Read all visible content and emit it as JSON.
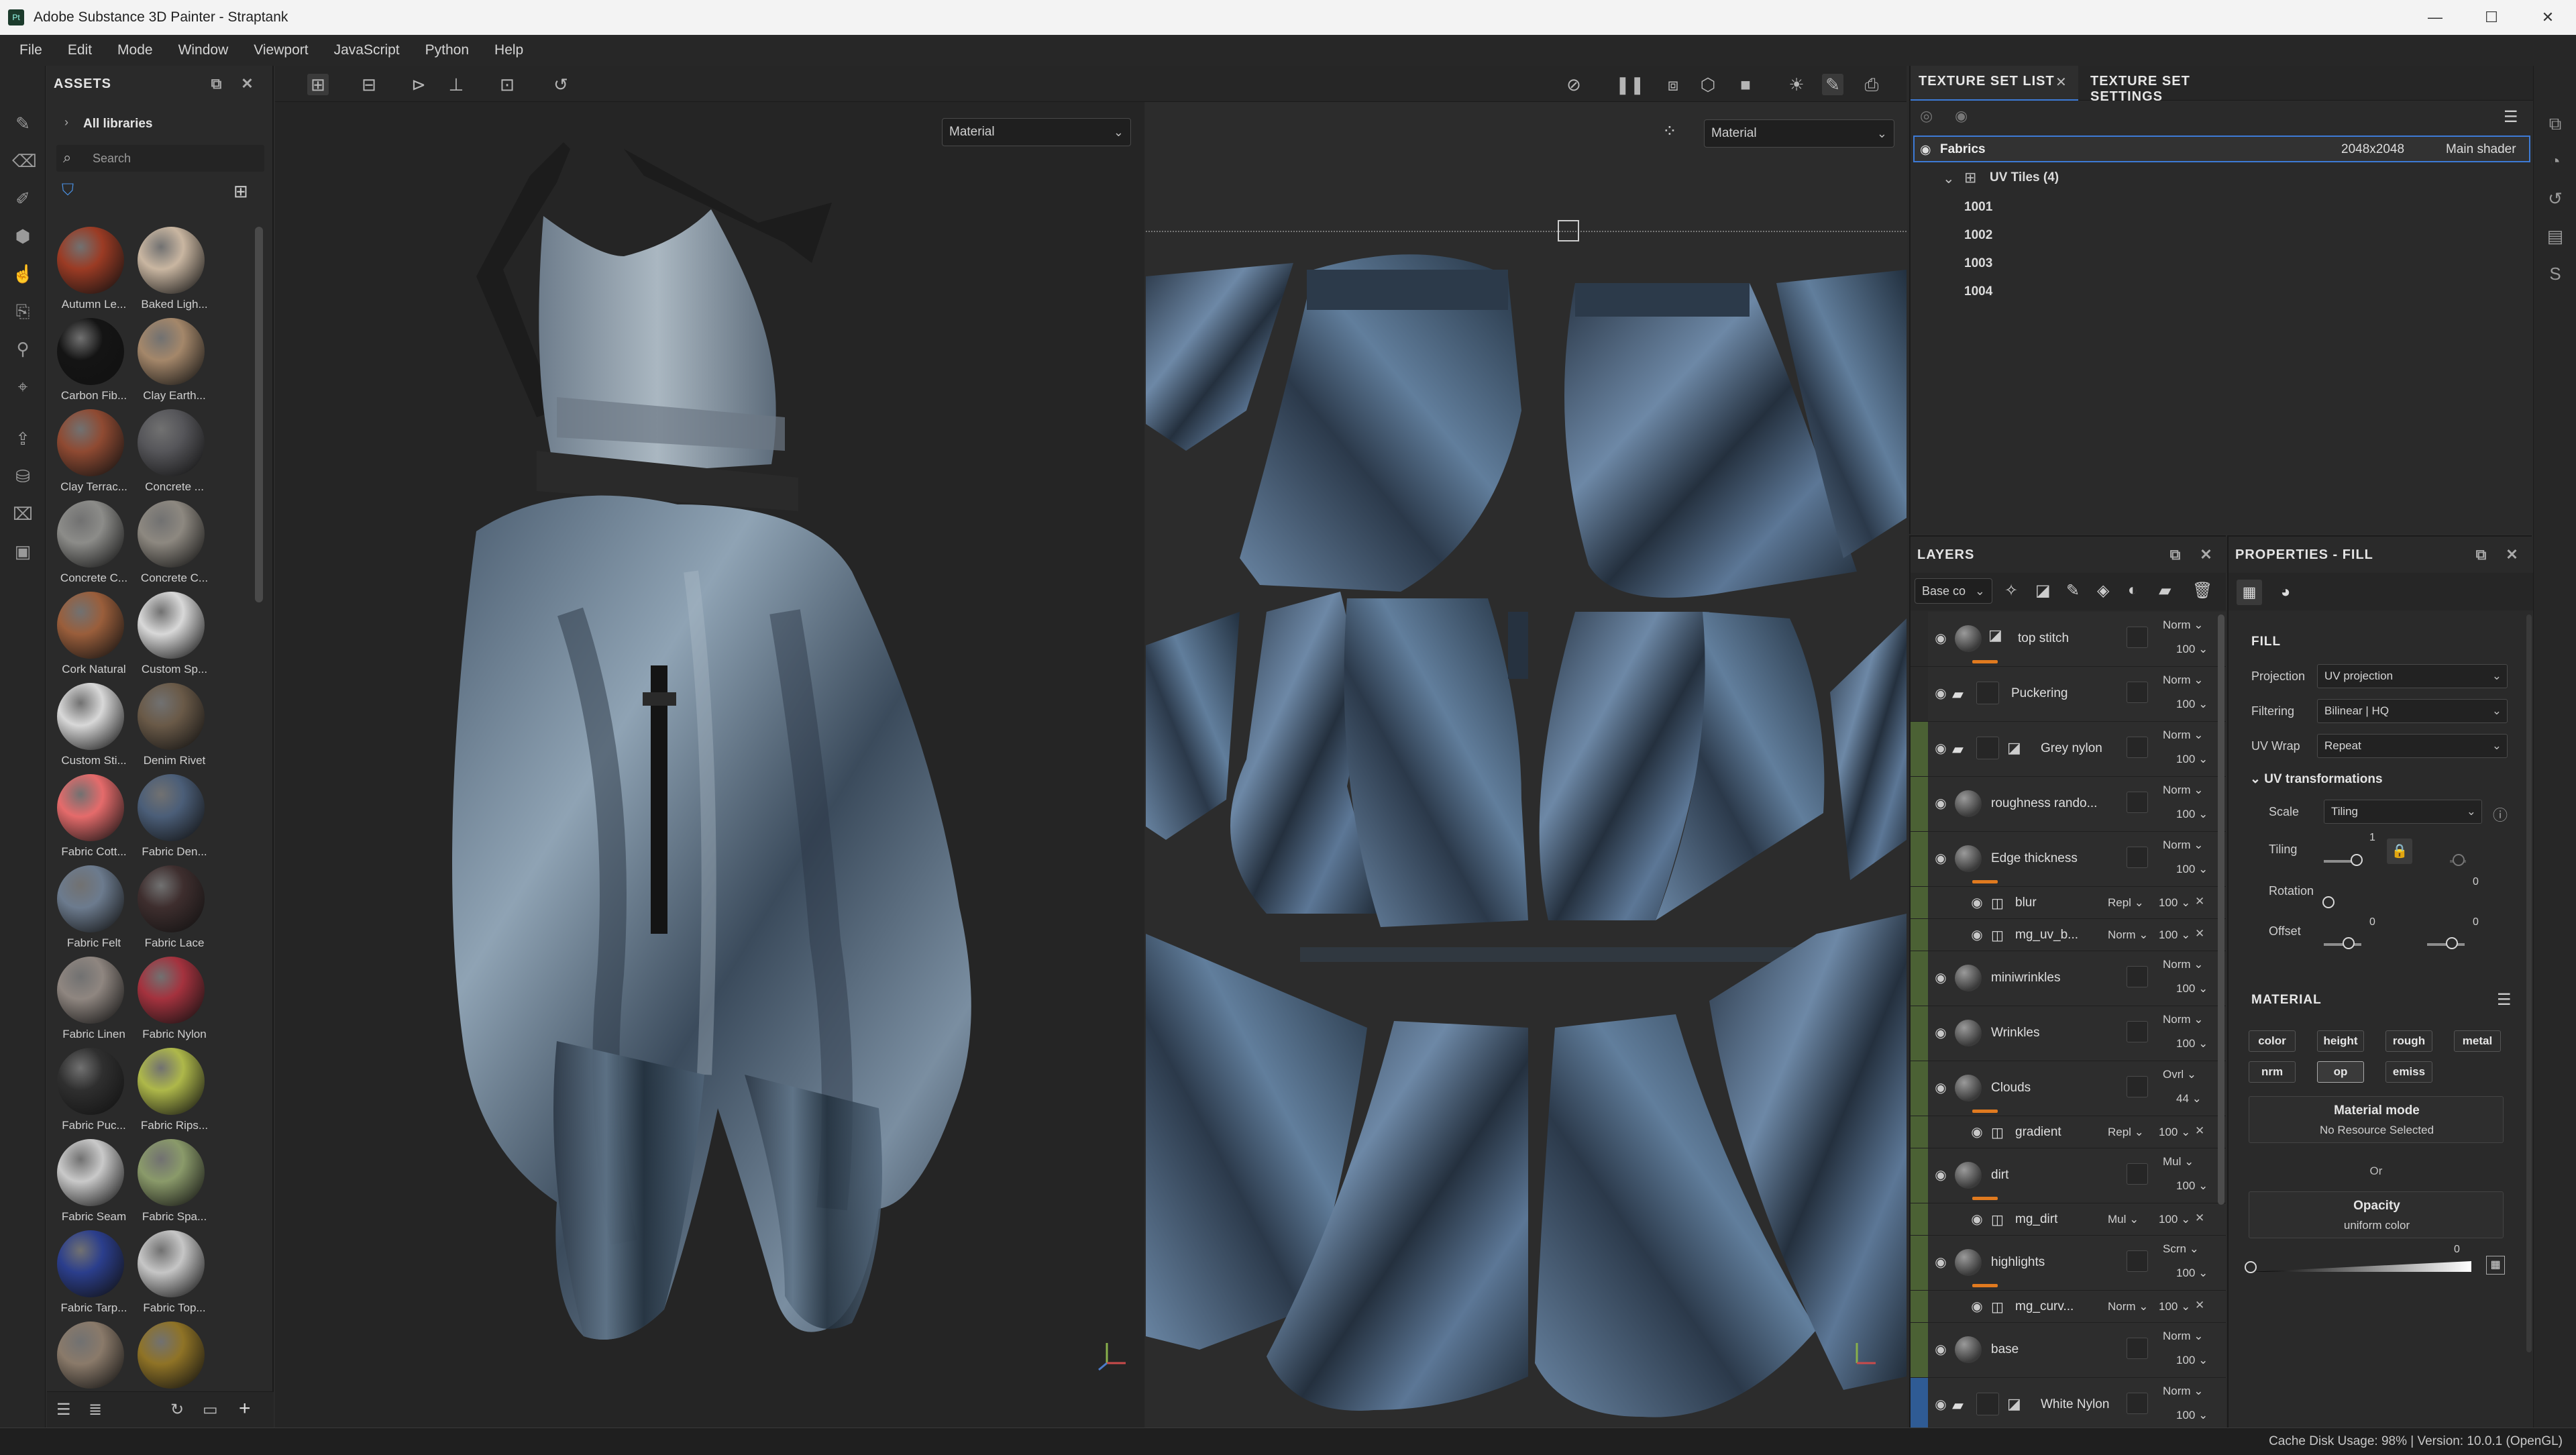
{
  "window": {
    "title": "Adobe Substance 3D Painter - Straptank",
    "app_icon": "Pt",
    "minimize": "—",
    "maximize": "☐",
    "close": "✕"
  },
  "menu": [
    "File",
    "Edit",
    "Mode",
    "Window",
    "Viewport",
    "JavaScript",
    "Python",
    "Help"
  ],
  "assets": {
    "title": "ASSETS",
    "library": "All libraries",
    "search_placeholder": "Search",
    "materials": [
      {
        "label": "Autumn Le...",
        "color": "#9b3b24"
      },
      {
        "label": "Baked Ligh...",
        "color": "#c9b6a1"
      },
      {
        "label": "Carbon Fib...",
        "color": "#141414"
      },
      {
        "label": "Clay Earth...",
        "color": "#a4876a"
      },
      {
        "label": "Clay Terrac...",
        "color": "#8f4a32"
      },
      {
        "label": "Concrete ...",
        "color": "#56565a"
      },
      {
        "label": "Concrete C...",
        "color": "#8c8c89"
      },
      {
        "label": "Concrete C...",
        "color": "#8d8880"
      },
      {
        "label": "Cork Natural",
        "color": "#9a5e3b"
      },
      {
        "label": "Custom Sp...",
        "color": "#d8d8d8"
      },
      {
        "label": "Custom Sti...",
        "color": "#d8d8d8"
      },
      {
        "label": "Denim Rivet",
        "color": "#6a5a48"
      },
      {
        "label": "Fabric Cott...",
        "color": "#e56b6b"
      },
      {
        "label": "Fabric Den...",
        "color": "#4b5e78"
      },
      {
        "label": "Fabric Felt",
        "color": "#6c7b8e"
      },
      {
        "label": "Fabric Lace",
        "color": "#3e2e2e"
      },
      {
        "label": "Fabric Linen",
        "color": "#8f8680"
      },
      {
        "label": "Fabric Nylon",
        "color": "#a4323e"
      },
      {
        "label": "Fabric Puc...",
        "color": "#2f2f2f"
      },
      {
        "label": "Fabric Rips...",
        "color": "#aeb84a"
      },
      {
        "label": "Fabric Seam",
        "color": "#c9c9c9"
      },
      {
        "label": "Fabric Spa...",
        "color": "#8a9a6a"
      },
      {
        "label": "Fabric Tarp...",
        "color": "#2b3e8c"
      },
      {
        "label": "Fabric Top...",
        "color": "#c6c6c6"
      },
      {
        "label": "",
        "color": "#8a7a6a"
      },
      {
        "label": "",
        "color": "#8f7326"
      }
    ]
  },
  "viewport": {
    "left_mode": "Material",
    "right_mode": "Material"
  },
  "texture_set": {
    "tab_list": "TEXTURE SET LIST",
    "tab_settings": "TEXTURE SET SETTINGS",
    "row_name": "Fabrics",
    "row_res": "2048x2048",
    "row_shader": "Main shader",
    "uv_group": "UV Tiles (4)",
    "tiles": [
      "1001",
      "1002",
      "1003",
      "1004"
    ]
  },
  "layers": {
    "title": "LAYERS",
    "channel": "Base co",
    "rows": [
      {
        "name": "top stitch",
        "blend": "Norm",
        "opacity": "100",
        "kind": "fill",
        "gut": "",
        "orange": true
      },
      {
        "name": "Puckering",
        "blend": "Norm",
        "opacity": "100",
        "kind": "folder",
        "gut": "",
        "orange": false
      },
      {
        "name": "Grey nylon",
        "blend": "Norm",
        "opacity": "100",
        "kind": "folder",
        "gut": "green",
        "orange": false
      },
      {
        "name": "roughness rando...",
        "blend": "Norm",
        "opacity": "100",
        "kind": "fill",
        "gut": "green",
        "orange": false
      },
      {
        "name": "Edge thickness",
        "blend": "Norm",
        "opacity": "100",
        "kind": "fill",
        "gut": "green",
        "orange": true
      },
      {
        "name": "blur",
        "blend": "Repl",
        "opacity": "100",
        "kind": "effect",
        "gut": "green",
        "orange": false
      },
      {
        "name": "mg_uv_b...",
        "blend": "Norm",
        "opacity": "100",
        "kind": "effect",
        "gut": "green",
        "orange": false
      },
      {
        "name": "miniwrinkles",
        "blend": "Norm",
        "opacity": "100",
        "kind": "fill",
        "gut": "green",
        "orange": false
      },
      {
        "name": "Wrinkles",
        "blend": "Norm",
        "opacity": "100",
        "kind": "fill",
        "gut": "green",
        "orange": false
      },
      {
        "name": "Clouds",
        "blend": "Ovrl",
        "opacity": "44",
        "kind": "fill",
        "gut": "green",
        "orange": true
      },
      {
        "name": "gradient",
        "blend": "Repl",
        "opacity": "100",
        "kind": "effect",
        "gut": "green",
        "orange": false
      },
      {
        "name": "dirt",
        "blend": "Mul",
        "opacity": "100",
        "kind": "fill",
        "gut": "green",
        "orange": true
      },
      {
        "name": "mg_dirt",
        "blend": "Mul",
        "opacity": "100",
        "kind": "effect",
        "gut": "green",
        "orange": false
      },
      {
        "name": "highlights",
        "blend": "Scrn",
        "opacity": "100",
        "kind": "fill",
        "gut": "green",
        "orange": true
      },
      {
        "name": "mg_curv...",
        "blend": "Norm",
        "opacity": "100",
        "kind": "effect",
        "gut": "green",
        "orange": false
      },
      {
        "name": "base",
        "blend": "Norm",
        "opacity": "100",
        "kind": "fill",
        "gut": "green",
        "orange": false
      },
      {
        "name": "White Nylon",
        "blend": "Norm",
        "opacity": "100",
        "kind": "folder",
        "gut": "blue",
        "orange": false
      }
    ]
  },
  "properties": {
    "title": "PROPERTIES - FILL",
    "fill": "FILL",
    "projection_label": "Projection",
    "projection": "UV projection",
    "filtering_label": "Filtering",
    "filtering": "Bilinear | HQ",
    "uvwrap_label": "UV Wrap",
    "uvwrap": "Repeat",
    "uvtrans": "UV transformations",
    "scale_label": "Scale",
    "scale": "Tiling",
    "tiling_label": "Tiling",
    "tiling_value": "1",
    "rotation_label": "Rotation",
    "rotation_value": "0",
    "offset_label": "Offset",
    "offset_x": "0",
    "offset_y": "0",
    "material": "MATERIAL",
    "channels": [
      "color",
      "height",
      "rough",
      "metal",
      "nrm",
      "op",
      "emiss"
    ],
    "material_mode": "Material mode",
    "no_resource": "No Resource Selected",
    "or": "Or",
    "opacity_title": "Opacity",
    "opacity_sub": "uniform color",
    "opacity_value": "0"
  },
  "status": "Cache Disk Usage:  98% | Version: 10.0.1 (OpenGL)"
}
